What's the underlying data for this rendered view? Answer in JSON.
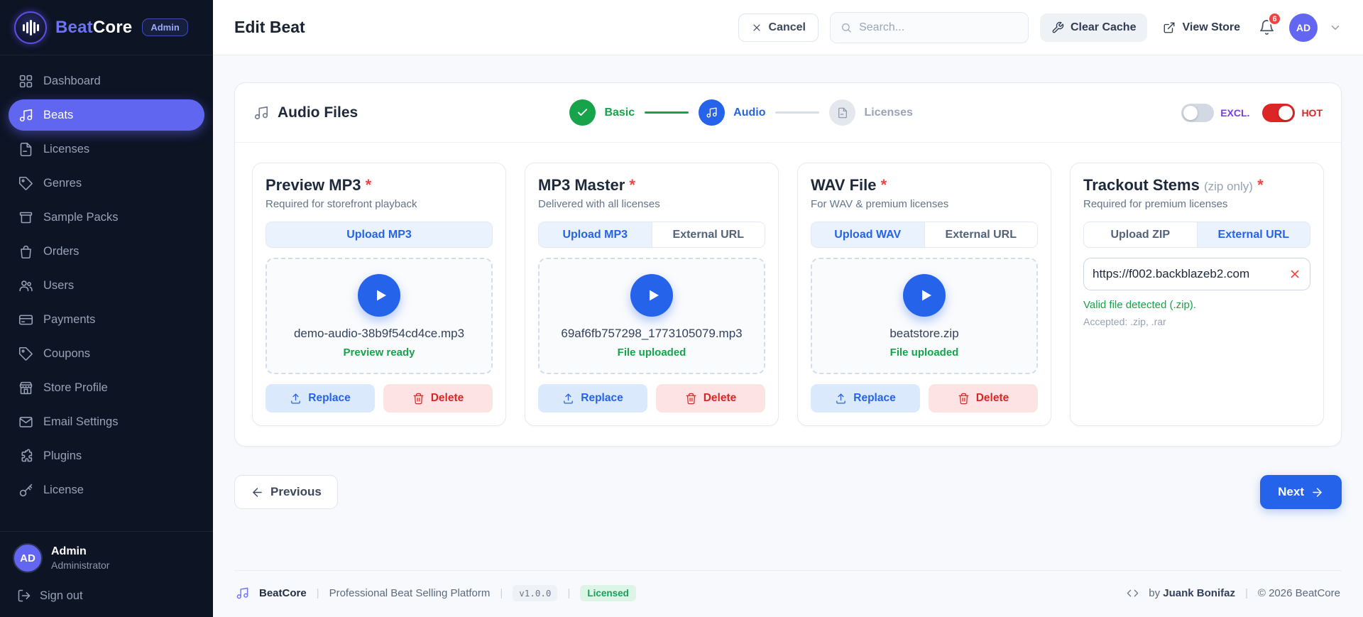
{
  "brand": {
    "name_primary": "Beat",
    "name_secondary": "Core",
    "badge": "Admin"
  },
  "sidebar": {
    "items": [
      {
        "label": "Dashboard",
        "icon": "dashboard-icon",
        "active": false
      },
      {
        "label": "Beats",
        "icon": "music-note-icon",
        "active": true
      },
      {
        "label": "Licenses",
        "icon": "document-icon",
        "active": false
      },
      {
        "label": "Genres",
        "icon": "tag-icon",
        "active": false
      },
      {
        "label": "Sample Packs",
        "icon": "box-icon",
        "active": false
      },
      {
        "label": "Orders",
        "icon": "shopping-bag-icon",
        "active": false
      },
      {
        "label": "Users",
        "icon": "users-icon",
        "active": false
      },
      {
        "label": "Payments",
        "icon": "credit-card-icon",
        "active": false
      },
      {
        "label": "Coupons",
        "icon": "tag-icon",
        "active": false
      },
      {
        "label": "Store Profile",
        "icon": "storefront-icon",
        "active": false
      },
      {
        "label": "Email Settings",
        "icon": "envelope-icon",
        "active": false
      },
      {
        "label": "Plugins",
        "icon": "puzzle-icon",
        "active": false
      },
      {
        "label": "License",
        "icon": "key-icon",
        "active": false
      }
    ],
    "user": {
      "initials": "AD",
      "name": "Admin",
      "role": "Administrator"
    },
    "signout_label": "Sign out"
  },
  "header": {
    "title": "Edit Beat",
    "cancel_label": "Cancel",
    "search_placeholder": "Search...",
    "clear_cache_label": "Clear Cache",
    "view_store_label": "View Store",
    "notification_count": "6",
    "avatar_initials": "AD"
  },
  "section": {
    "title": "Audio Files",
    "steps": [
      {
        "label": "Basic",
        "state": "completed"
      },
      {
        "label": "Audio",
        "state": "active"
      },
      {
        "label": "Licenses",
        "state": "upcoming"
      }
    ],
    "toggles": {
      "exclusive": {
        "label": "EXCL.",
        "on": false
      },
      "hot": {
        "label": "HOT",
        "on": true
      }
    }
  },
  "cards": [
    {
      "title": "Preview MP3",
      "required_mark": "*",
      "subtitle": "Required for storefront playback",
      "tabs": [
        {
          "label": "Upload MP3",
          "active": true
        }
      ],
      "file": {
        "name": "demo-audio-38b9f54cd4ce.mp3",
        "status": "Preview ready"
      },
      "replace_label": "Replace",
      "delete_label": "Delete"
    },
    {
      "title": "MP3 Master",
      "required_mark": "*",
      "subtitle": "Delivered with all licenses",
      "tabs": [
        {
          "label": "Upload MP3",
          "active": true
        },
        {
          "label": "External URL",
          "active": false
        }
      ],
      "file": {
        "name": "69af6fb757298_1773105079.mp3",
        "status": "File uploaded"
      },
      "replace_label": "Replace",
      "delete_label": "Delete"
    },
    {
      "title": "WAV File",
      "required_mark": "*",
      "subtitle": "For WAV & premium licenses",
      "tabs": [
        {
          "label": "Upload WAV",
          "active": true
        },
        {
          "label": "External URL",
          "active": false
        }
      ],
      "file": {
        "name": "beatstore.zip",
        "status": "File uploaded"
      },
      "replace_label": "Replace",
      "delete_label": "Delete"
    },
    {
      "title": "Trackout Stems",
      "title_note": "(zip only)",
      "required_mark": "*",
      "subtitle": "Required for premium licenses",
      "tabs": [
        {
          "label": "Upload ZIP",
          "active": false
        },
        {
          "label": "External URL",
          "active": true
        }
      ],
      "url_value": "https://f002.backblazeb2.com",
      "validation_message": "Valid file detected (.zip).",
      "accepted_note": "Accepted: .zip, .rar"
    }
  ],
  "pagination": {
    "previous_label": "Previous",
    "next_label": "Next"
  },
  "footer": {
    "brand": "BeatCore",
    "tagline": "Professional Beat Selling Platform",
    "version": "v1.0.0",
    "license_badge": "Licensed",
    "credit_prefix": "by",
    "credit_name": "Juank Bonifaz",
    "copyright": "© 2026 BeatCore"
  },
  "colors": {
    "accent_indigo": "#6366f1",
    "primary_blue": "#2563eb",
    "success_green": "#16a34a",
    "danger_red": "#dc2626",
    "exclusive_purple": "#7c3aed",
    "sidebar_bg": "#0d1424",
    "content_bg": "#f7f9fc"
  }
}
